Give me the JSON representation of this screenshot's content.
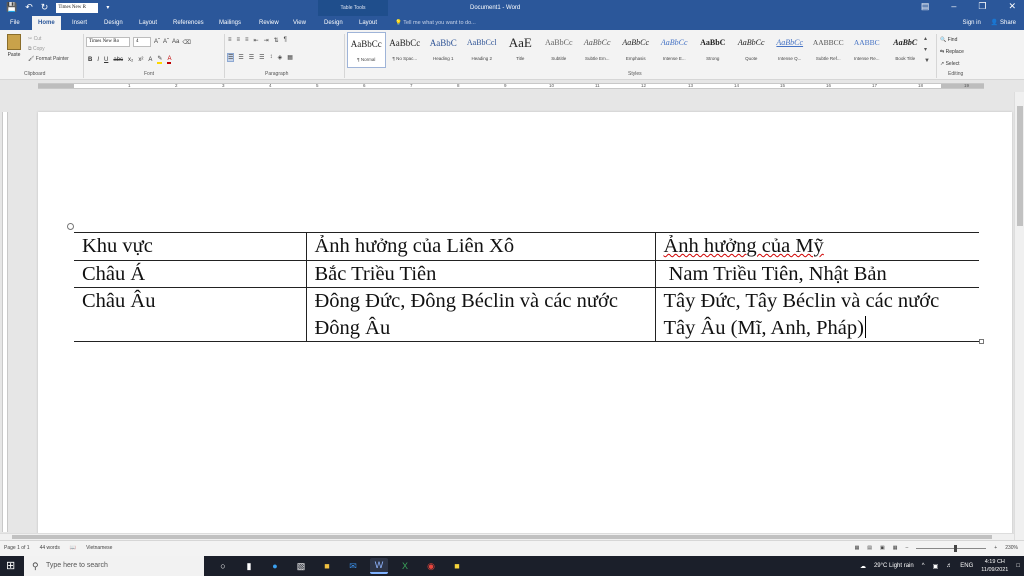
{
  "titlebar": {
    "font_box": "Times New R",
    "font_size": "",
    "table_tools": "Table Tools",
    "doc_title": "Document1 - Word"
  },
  "tabs": [
    "File",
    "Home",
    "Insert",
    "Design",
    "Layout",
    "References",
    "Mailings",
    "Review",
    "View",
    "Design",
    "Layout"
  ],
  "tell_me": "Tell me what you want to do...",
  "account": {
    "signin": "Sign in",
    "share": "Share"
  },
  "clipboard": {
    "paste": "Paste",
    "cut": "Cut",
    "copy": "Copy",
    "format_painter": "Format Painter",
    "label": "Clipboard"
  },
  "font": {
    "name": "Times New Ro",
    "size": "4",
    "label": "Font"
  },
  "paragraph": {
    "label": "Paragraph"
  },
  "styles": {
    "label": "Styles",
    "items": [
      {
        "preview": "AaBbCc",
        "name": "¶ Normal"
      },
      {
        "preview": "AaBbCc",
        "name": "¶ No Spac..."
      },
      {
        "preview": "AaBbC",
        "name": "Heading 1"
      },
      {
        "preview": "AaBbCcl",
        "name": "Heading 2"
      },
      {
        "preview": "AaE",
        "name": "Title"
      },
      {
        "preview": "AaBbCc",
        "name": "Subtitle"
      },
      {
        "preview": "AaBbCc",
        "name": "Subtle Em..."
      },
      {
        "preview": "AaBbCc",
        "name": "Emphasis"
      },
      {
        "preview": "AaBbCc",
        "name": "Intense E..."
      },
      {
        "preview": "AaBbC",
        "name": "Strong"
      },
      {
        "preview": "AaBbCc",
        "name": "Quote"
      },
      {
        "preview": "AaBbCc",
        "name": "Intense Q..."
      },
      {
        "preview": "AABBCC",
        "name": "Subtle Ref..."
      },
      {
        "preview": "AABBC",
        "name": "Intense Re..."
      },
      {
        "preview": "AaBbC",
        "name": "Book Title"
      }
    ]
  },
  "editing": {
    "find": "Find",
    "replace": "Replace",
    "select": "Select",
    "label": "Editing"
  },
  "table": {
    "rows": [
      [
        "Khu vực",
        "Ảnh hưởng của Liên Xô",
        "Ảnh hưởng của Mỹ"
      ],
      [
        "Châu Á",
        "Bắc Triều Tiên",
        " Nam Triều Tiên, Nhật Bản"
      ],
      [
        "Châu Âu",
        "Đông Đức, Đông Béclin và các nước Đông Âu",
        "Tây Đức, Tây Béclin và các nước Tây Âu (Mĩ, Anh, Pháp)"
      ]
    ]
  },
  "status": {
    "page": "Page 1 of 1",
    "words": "44 words",
    "language": "Vietnamese",
    "zoom": "230%"
  },
  "taskbar": {
    "search_placeholder": "Type here to search",
    "weather": "29°C  Light rain",
    "lang": "ENG",
    "time": "4:19 CH",
    "date": "11/09/2021"
  },
  "ruler_numbers": [
    "1",
    "2",
    "3",
    "4",
    "5",
    "6",
    "7",
    "8",
    "9",
    "10",
    "11",
    "12",
    "13",
    "14",
    "15",
    "16",
    "17",
    "18",
    "19"
  ],
  "colors": {
    "word_blue": "#2b579a",
    "page": "#ffffff",
    "canvas": "#e6e6e6"
  }
}
